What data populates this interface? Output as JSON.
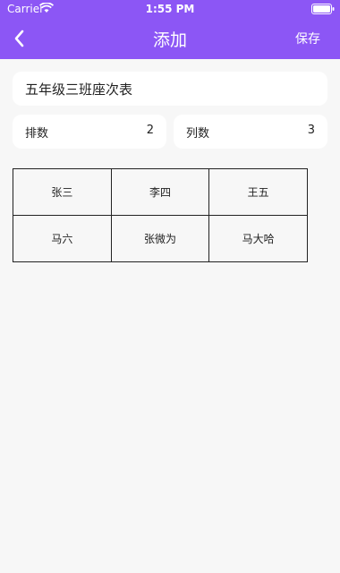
{
  "status_bar": {
    "carrier": "Carrier",
    "time": "1:55 PM"
  },
  "nav": {
    "title": "添加",
    "save_label": "保存",
    "back_icon": "chevron-left-icon",
    "accent_color": "#8c56f5"
  },
  "form": {
    "title_value": "五年级三班座次表",
    "rows_label": "排数",
    "rows_value": "2",
    "cols_label": "列数",
    "cols_value": "3"
  },
  "seats": [
    [
      "张三",
      "李四",
      "王五"
    ],
    [
      "马六",
      "张微为",
      "马大哈"
    ]
  ]
}
